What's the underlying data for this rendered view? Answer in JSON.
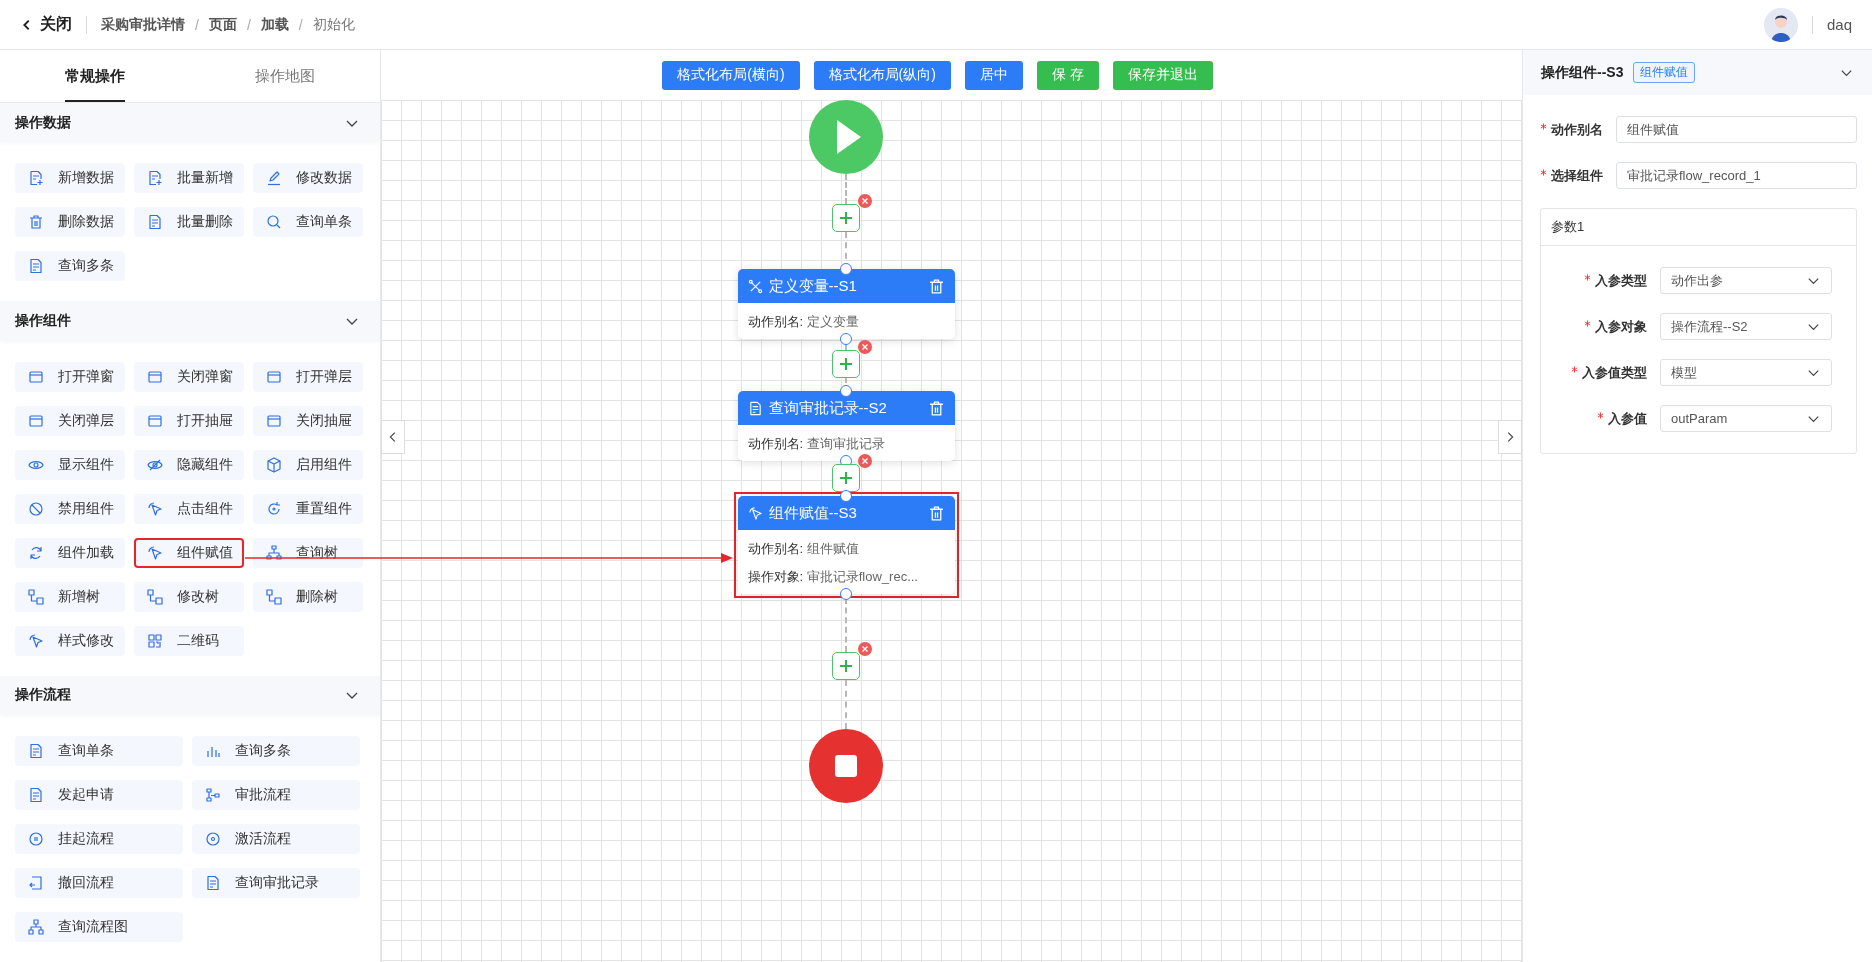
{
  "header": {
    "close_label": "关闭",
    "breadcrumb": [
      {
        "label": "采购审批详情"
      },
      {
        "label": "页面"
      },
      {
        "label": "加载"
      },
      {
        "label": "初始化"
      }
    ],
    "separator": "/",
    "user": {
      "name": "daq"
    }
  },
  "left_panel": {
    "tabs": [
      {
        "label": "常规操作",
        "selected": true
      },
      {
        "label": "操作地图",
        "selected": false
      }
    ],
    "sections": [
      {
        "title": "操作数据",
        "expanded": true,
        "kind": "three-column",
        "items": [
          {
            "label": "新增数据",
            "highlighted": false
          },
          {
            "label": "批量新增",
            "highlighted": false
          },
          {
            "label": "修改数据",
            "highlighted": false
          },
          {
            "label": "删除数据",
            "highlighted": false
          },
          {
            "label": "批量删除",
            "highlighted": false
          },
          {
            "label": "查询单条",
            "highlighted": false
          },
          {
            "label": "查询多条",
            "highlighted": false
          }
        ]
      },
      {
        "title": "操作组件",
        "expanded": true,
        "kind": "three-column",
        "items": [
          {
            "label": "打开弹窗",
            "highlighted": false
          },
          {
            "label": "关闭弹窗",
            "highlighted": false
          },
          {
            "label": "打开弹层",
            "highlighted": false
          },
          {
            "label": "关闭弹层",
            "highlighted": false
          },
          {
            "label": "打开抽屉",
            "highlighted": false
          },
          {
            "label": "关闭抽屉",
            "highlighted": false
          },
          {
            "label": "显示组件",
            "highlighted": false
          },
          {
            "label": "隐藏组件",
            "highlighted": false
          },
          {
            "label": "启用组件",
            "highlighted": false
          },
          {
            "label": "禁用组件",
            "highlighted": false
          },
          {
            "label": "点击组件",
            "highlighted": false
          },
          {
            "label": "重置组件",
            "highlighted": false
          },
          {
            "label": "组件加载",
            "highlighted": false
          },
          {
            "label": "组件赋值",
            "highlighted": true
          },
          {
            "label": "查询树",
            "highlighted": false
          },
          {
            "label": "新增树",
            "highlighted": false
          },
          {
            "label": "修改树",
            "highlighted": false
          },
          {
            "label": "删除树",
            "highlighted": false
          },
          {
            "label": "样式修改",
            "highlighted": false
          },
          {
            "label": "二维码",
            "highlighted": false
          }
        ]
      },
      {
        "title": "操作流程",
        "expanded": true,
        "kind": "two-column",
        "items": [
          {
            "label": "查询单条",
            "highlighted": false
          },
          {
            "label": "查询多条",
            "highlighted": false
          },
          {
            "label": "发起申请",
            "highlighted": false
          },
          {
            "label": "审批流程",
            "highlighted": false
          },
          {
            "label": "挂起流程",
            "highlighted": false
          },
          {
            "label": "激活流程",
            "highlighted": false
          },
          {
            "label": "撤回流程",
            "highlighted": false
          },
          {
            "label": "查询审批记录",
            "highlighted": false
          },
          {
            "label": "查询流程图",
            "highlighted": false
          }
        ]
      }
    ]
  },
  "canvas": {
    "toolbar": [
      {
        "label": "格式化布局(横向)",
        "kind": "primary"
      },
      {
        "label": "格式化布局(纵向)",
        "kind": "primary"
      },
      {
        "label": "居中",
        "kind": "primary"
      },
      {
        "label": "保 存",
        "kind": "success"
      },
      {
        "label": "保存并退出",
        "kind": "success"
      }
    ],
    "nodes": [
      {
        "title": "定义变量--S1",
        "highlighted": false,
        "fields": [
          {
            "label": "动作别名:",
            "value": "定义变量"
          }
        ]
      },
      {
        "title": "查询审批记录--S2",
        "highlighted": false,
        "fields": [
          {
            "label": "动作别名:",
            "value": "查询审批记录"
          }
        ]
      },
      {
        "title": "组件赋值--S3",
        "highlighted": true,
        "fields": [
          {
            "label": "动作别名:",
            "value": "组件赋值"
          },
          {
            "label": "操作对象:",
            "value": "审批记录flow_rec..."
          }
        ]
      }
    ]
  },
  "right_panel": {
    "title": "操作组件--S3",
    "tag": "组件赋值",
    "expanded": true,
    "fields": [
      {
        "label": "动作别名",
        "required": true,
        "kind": "input",
        "value": "组件赋值"
      },
      {
        "label": "选择组件",
        "required": true,
        "kind": "input",
        "value": "审批记录flow_record_1"
      }
    ],
    "group": {
      "title": "参数1",
      "fields": [
        {
          "label": "入参类型",
          "required": true,
          "kind": "select",
          "value": "动作出参"
        },
        {
          "label": "入参对象",
          "required": true,
          "kind": "select",
          "value": "操作流程--S2"
        },
        {
          "label": "入参值类型",
          "required": true,
          "kind": "select",
          "value": "模型"
        },
        {
          "label": "入参值",
          "required": true,
          "kind": "select",
          "value": "outParam"
        }
      ]
    }
  }
}
